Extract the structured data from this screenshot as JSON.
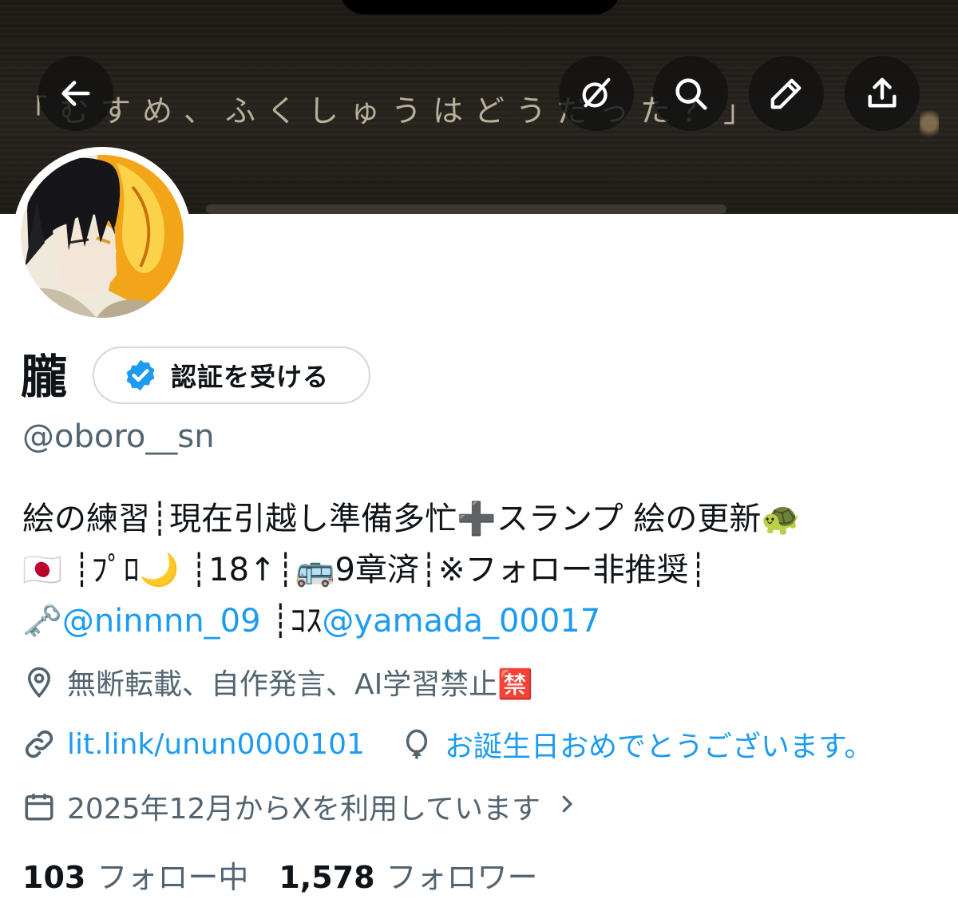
{
  "banner": {
    "caption": "「むすめ、ふくしゅうはどうだった？」"
  },
  "toolbar": {
    "back": "back-arrow-icon",
    "grok": "grok-icon",
    "search": "search-icon",
    "edit": "pencil-icon",
    "share": "share-icon"
  },
  "profile": {
    "display_name": "朧",
    "verify_label": "認証を受ける",
    "handle": "@oboro__sn"
  },
  "bio": {
    "line1": "絵の練習┊現在引越し準備多忙➕スランプ 絵の更新🐢",
    "line2": "🇯🇵 ┊ﾌﾟﾛ🌙 ┊18↑┊🚌9章済┊※フォロー非推奨┊",
    "line3_prefix": "🗝️",
    "line3_mention1": "@ninnnn_09",
    "line3_mid": " ┊ｺｽ",
    "line3_mention2": "@yamada_00017"
  },
  "meta": {
    "location": "無断転載、自作発言、AI学習禁止🈲",
    "website": "lit.link/unun0000101",
    "birthday": "お誕生日おめでとうございます。",
    "joined": "2025年12月からXを利用しています"
  },
  "stats": {
    "following_count": "103",
    "following_label": "フォロー中",
    "followers_count": "1,578",
    "followers_label": "フォロワー"
  },
  "colors": {
    "accent": "#1d9bf0",
    "secondary_text": "#536471",
    "verified_badge": "#1d9bf0"
  }
}
